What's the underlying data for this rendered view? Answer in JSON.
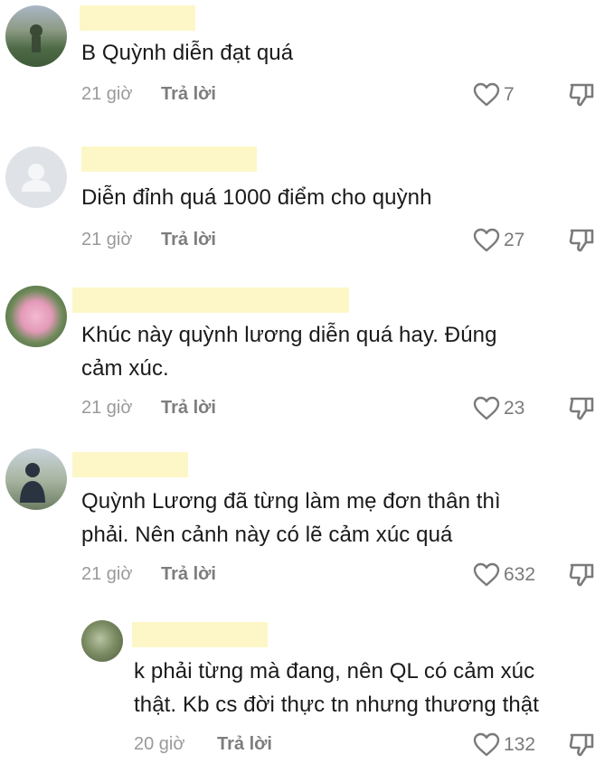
{
  "comments": [
    {
      "text": "B Quỳnh diễn đạt quá",
      "time": "21 giờ",
      "reply": "Trả lời",
      "likes": "7"
    },
    {
      "text": "Diễn đỉnh quá 1000 điểm cho quỳnh",
      "time": "21 giờ",
      "reply": "Trả lời",
      "likes": "27"
    },
    {
      "text": "Khúc này quỳnh lương diễn quá hay. Đúng\ncảm xúc.",
      "time": "21 giờ",
      "reply": "Trả lời",
      "likes": "23"
    },
    {
      "text": "Quỳnh Lương đã từng làm mẹ đơn thân thì\nphải. Nên cảnh này có lẽ cảm xúc quá",
      "time": "21 giờ",
      "reply": "Trả lời",
      "likes": "632"
    },
    {
      "text": "k phải từng mà đang, nên QL có cảm xúc\nthật. Kb cs đời thực tn nhưng thương thật",
      "time": "20 giờ",
      "reply": "Trả lời",
      "likes": "132"
    }
  ],
  "colors": {
    "username_highlight": "#fdf7c7",
    "icon": "#7a7a7a"
  }
}
